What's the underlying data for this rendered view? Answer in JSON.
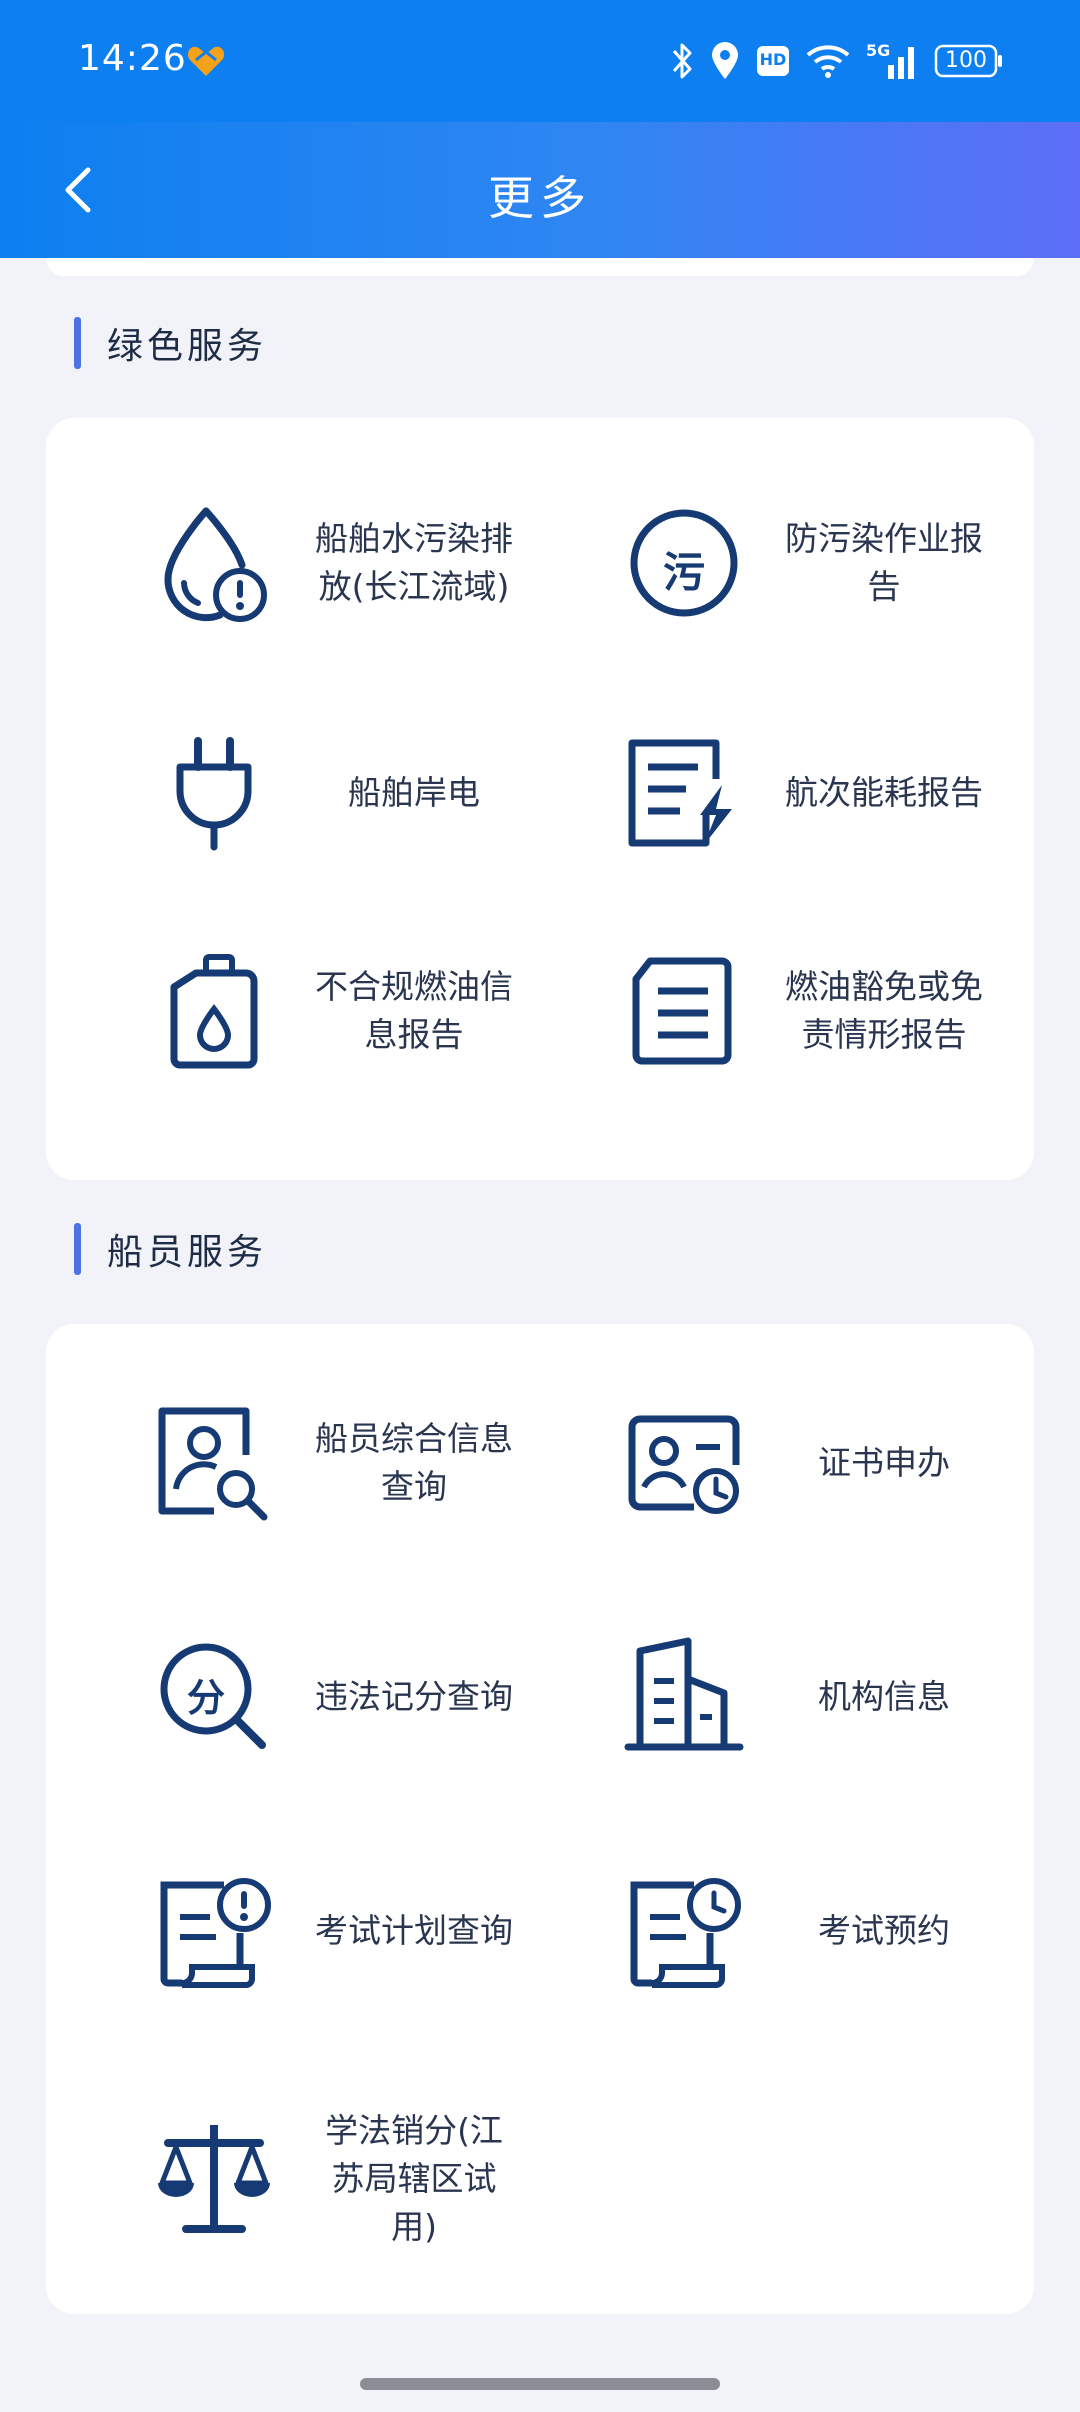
{
  "status_bar": {
    "time": "14:26",
    "icons": [
      "heart-badge-icon",
      "bluetooth-icon",
      "location-icon",
      "hd-icon",
      "wifi-icon",
      "signal-5g-icon",
      "battery-icon"
    ],
    "hd_label": "HD",
    "network_label": "5G",
    "battery": "100"
  },
  "header": {
    "title": "更多",
    "back_icon": "chevron-left-icon"
  },
  "sections": [
    {
      "title": "绿色服务",
      "items": [
        {
          "label": "船舶水污染排放(长江流域)",
          "icon": "water-drop-alert-icon"
        },
        {
          "label": "防污染作业报告",
          "icon": "pollution-circle-icon"
        },
        {
          "label": "船舶岸电",
          "icon": "power-plug-icon"
        },
        {
          "label": "航次能耗报告",
          "icon": "report-lightning-icon"
        },
        {
          "label": "不合规燃油信息报告",
          "icon": "fuel-can-icon"
        },
        {
          "label": "燃油豁免或免责情形报告",
          "icon": "document-lines-icon"
        }
      ]
    },
    {
      "title": "船员服务",
      "items": [
        {
          "label": "船员综合信息查询",
          "icon": "person-search-icon"
        },
        {
          "label": "证书申办",
          "icon": "certificate-clock-icon"
        },
        {
          "label": "违法记分查询",
          "icon": "score-search-icon"
        },
        {
          "label": "机构信息",
          "icon": "building-icon"
        },
        {
          "label": "考试计划查询",
          "icon": "exam-alert-icon"
        },
        {
          "label": "考试预约",
          "icon": "exam-clock-icon"
        },
        {
          "label": "学法销分(江苏局辖区试用)",
          "icon": "scales-icon"
        }
      ]
    }
  ],
  "glyphs": {
    "pollution": "污",
    "score": "分"
  },
  "colors": {
    "status_bar": "#0d7ff0",
    "header_gradient_end": "#5d6ef7",
    "icon": "#163a73",
    "accent_bar": "#4e72e3",
    "background": "#f1f3f9"
  }
}
